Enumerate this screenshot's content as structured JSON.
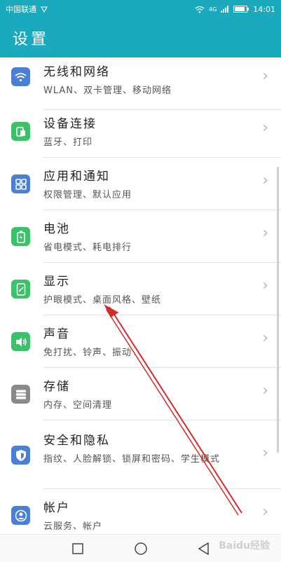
{
  "status_bar": {
    "carrier": "中国联通",
    "time": "14:01",
    "network": "4G"
  },
  "header": {
    "title": "设置"
  },
  "items": [
    {
      "title": "无线和网络",
      "subtitle": "WLAN、双卡管理、移动网络",
      "icon": "wifi-icon",
      "color": "#4a7fd4"
    },
    {
      "title": "设备连接",
      "subtitle": "蓝牙、打印",
      "icon": "device-connect-icon",
      "color": "#3cc06a"
    },
    {
      "title": "应用和通知",
      "subtitle": "权限管理、默认应用",
      "icon": "apps-icon",
      "color": "#4a7fd4"
    },
    {
      "title": "电池",
      "subtitle": "省电模式、耗电排行",
      "icon": "battery-icon",
      "color": "#3cc06a"
    },
    {
      "title": "显示",
      "subtitle": "护眼模式、桌面风格、壁纸",
      "icon": "display-icon",
      "color": "#3cc06a"
    },
    {
      "title": "声音",
      "subtitle": "免打扰、铃声、振动",
      "icon": "sound-icon",
      "color": "#3cc06a"
    },
    {
      "title": "存储",
      "subtitle": "内存、空间清理",
      "icon": "storage-icon",
      "color": "#8a8a8a"
    },
    {
      "title": "安全和隐私",
      "subtitle": "指纹、人脸解锁、锁屏和密码、学生模式",
      "icon": "shield-icon",
      "color": "#4a7fd4"
    },
    {
      "title": "帐户",
      "subtitle": "云服务、帐户",
      "icon": "account-icon",
      "color": "#4a7fd4"
    }
  ],
  "navbar": {
    "back": "back-icon",
    "home": "home-icon",
    "recents": "recents-icon"
  },
  "watermark": "Baidu经验"
}
